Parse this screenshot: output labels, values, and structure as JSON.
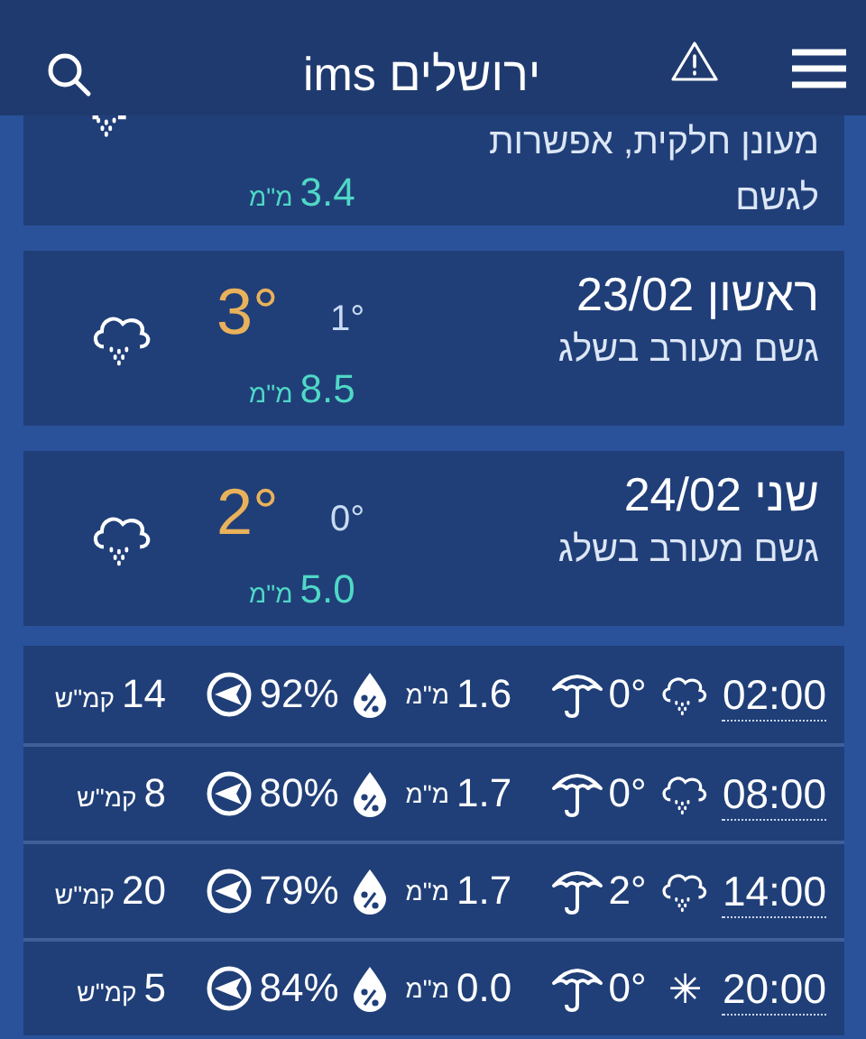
{
  "header": {
    "title": "ירושלים ims"
  },
  "days": [
    {
      "description": "מעונן חלקית, אפשרות לגשם",
      "precip": "3.4",
      "precip_unit": "מ\"מ",
      "kind": "rain"
    },
    {
      "date": "ראשון 23/02",
      "description": "גשם מעורב בשלג",
      "high": "3°",
      "low": "1°",
      "precip": "8.5",
      "precip_unit": "מ\"מ",
      "kind": "rain"
    },
    {
      "date": "שני 24/02",
      "description": "גשם מעורב בשלג",
      "high": "2°",
      "low": "0°",
      "precip": "5.0",
      "precip_unit": "מ\"מ",
      "kind": "rain"
    }
  ],
  "hours": [
    {
      "time": "02:00",
      "kind": "rain",
      "temp": "0°",
      "precip": "1.6",
      "precip_unit": "מ\"מ",
      "humidity": "92%",
      "wind": "14",
      "wind_unit": "קמ\"ש"
    },
    {
      "time": "08:00",
      "kind": "rain",
      "temp": "0°",
      "precip": "1.7",
      "precip_unit": "מ\"מ",
      "humidity": "80%",
      "wind": "8",
      "wind_unit": "קמ\"ש"
    },
    {
      "time": "14:00",
      "kind": "rain",
      "temp": "2°",
      "precip": "1.7",
      "precip_unit": "מ\"מ",
      "humidity": "79%",
      "wind": "20",
      "wind_unit": "קמ\"ש"
    },
    {
      "time": "20:00",
      "kind": "clear",
      "temp": "0°",
      "precip": "0.0",
      "precip_unit": "מ\"מ",
      "humidity": "84%",
      "wind": "5",
      "wind_unit": "קמ\"ש"
    }
  ]
}
